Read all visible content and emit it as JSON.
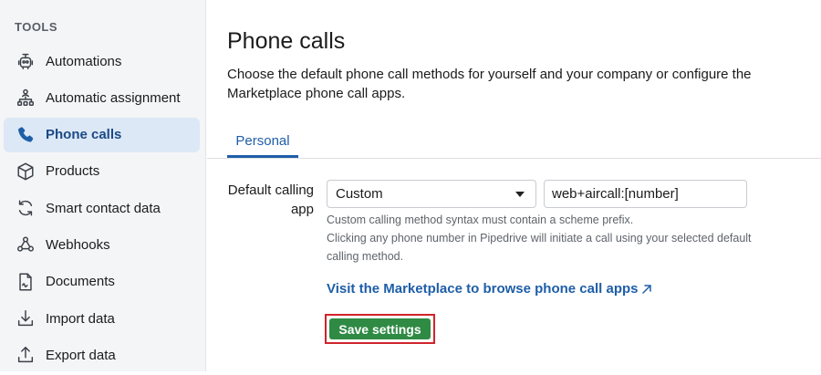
{
  "sidebar": {
    "section_label": "TOOLS",
    "items": [
      {
        "label": "Automations",
        "icon": "automations-icon"
      },
      {
        "label": "Automatic assignment",
        "icon": "assignment-icon"
      },
      {
        "label": "Phone calls",
        "icon": "phone-icon",
        "active": true
      },
      {
        "label": "Products",
        "icon": "box-icon"
      },
      {
        "label": "Smart contact data",
        "icon": "sync-icon"
      },
      {
        "label": "Webhooks",
        "icon": "webhook-icon"
      },
      {
        "label": "Documents",
        "icon": "document-icon"
      },
      {
        "label": "Import data",
        "icon": "download-icon"
      },
      {
        "label": "Export data",
        "icon": "upload-icon"
      }
    ]
  },
  "main": {
    "title": "Phone calls",
    "description": "Choose the default phone call methods for yourself and your company or configure the Marketplace phone call apps.",
    "tabs": [
      {
        "label": "Personal",
        "active": true
      }
    ],
    "form": {
      "field_label": "Default calling app",
      "select_value": "Custom",
      "input_value": "web+aircall:[number]",
      "help_line1": "Custom calling method syntax must contain a scheme prefix.",
      "help_line2": "Clicking any phone number in Pipedrive will initiate a call using your selected default calling method."
    },
    "marketplace_link": "Visit the Marketplace to browse phone call apps",
    "save_button": "Save settings"
  },
  "colors": {
    "accent": "#1e5ea8",
    "active_nav_bg": "#dde8f6",
    "save_button": "#2f8a44",
    "highlight_outline": "#d0242b"
  }
}
